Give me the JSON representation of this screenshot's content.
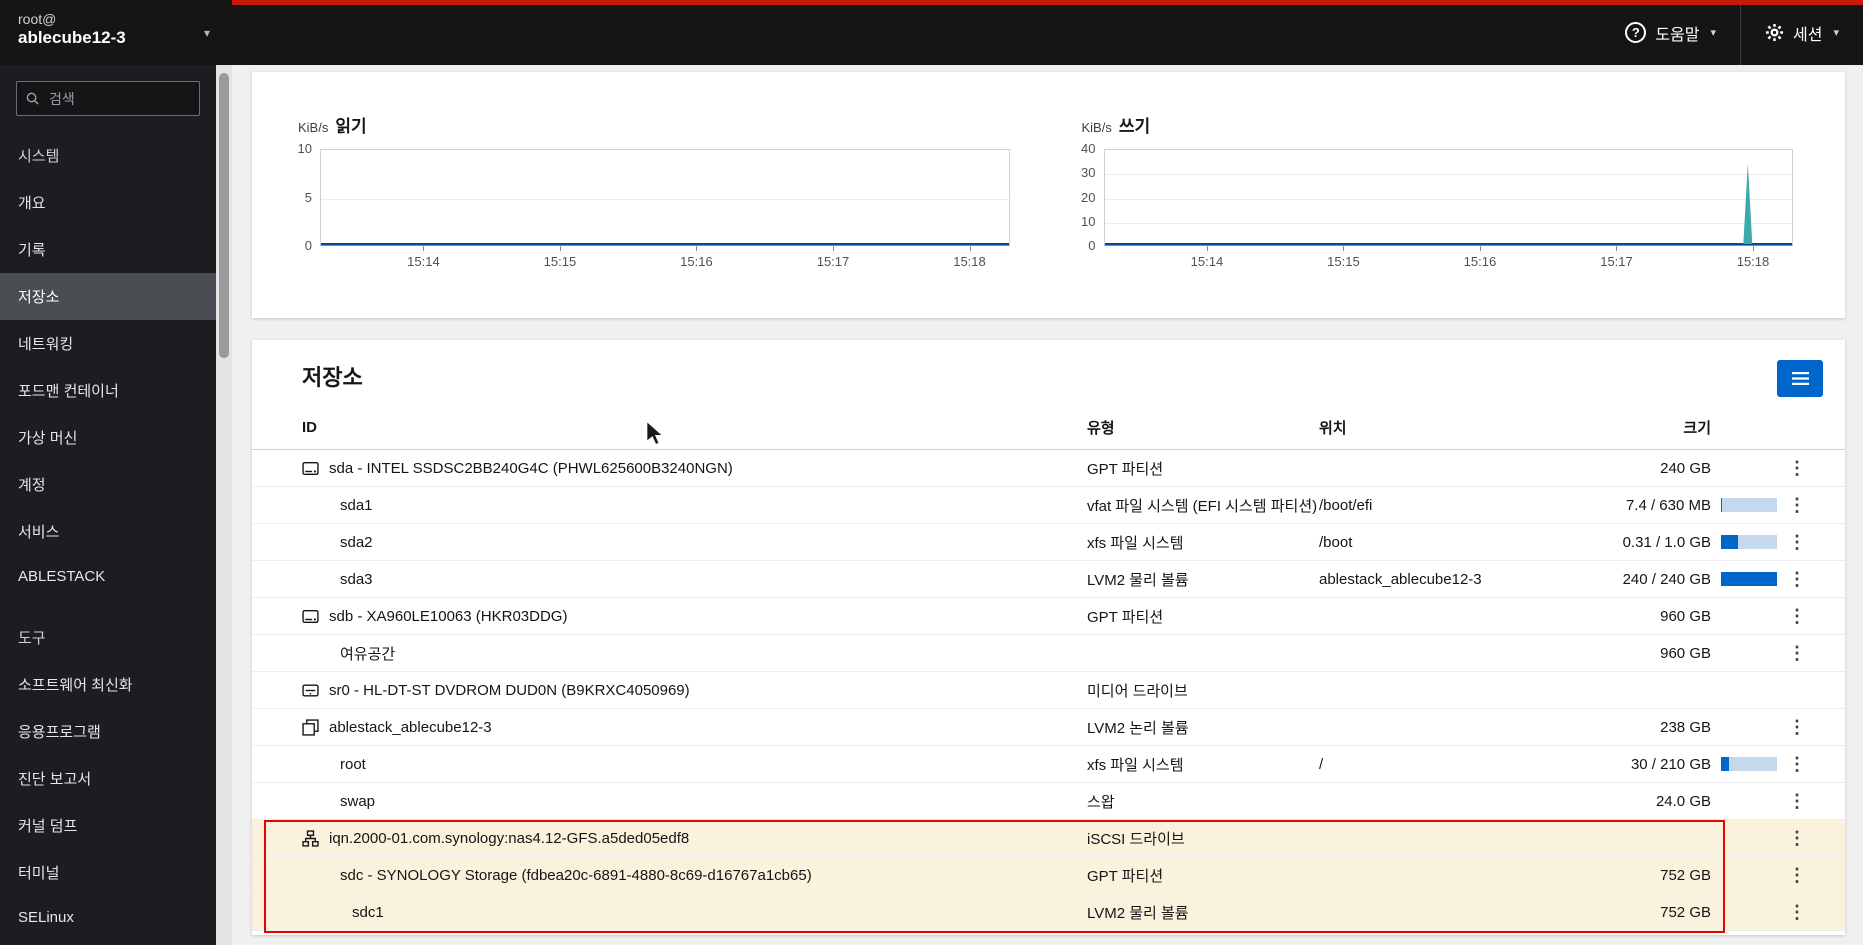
{
  "masthead": {
    "user_line": "root@",
    "host_line": "ablecube12-3",
    "help": {
      "label": "도움말",
      "icon": "question-circle-icon"
    },
    "session": {
      "label": "세션",
      "icon": "gear-icon"
    }
  },
  "sidebar": {
    "search_placeholder": "검색",
    "items": [
      {
        "key": "system",
        "label": "시스템",
        "type": "section",
        "selected": false,
        "gap_before": false
      },
      {
        "key": "overview",
        "label": "개요",
        "type": "item",
        "selected": false,
        "gap_before": false
      },
      {
        "key": "logs",
        "label": "기록",
        "type": "item",
        "selected": false,
        "gap_before": false
      },
      {
        "key": "storage",
        "label": "저장소",
        "type": "item",
        "selected": true,
        "gap_before": false
      },
      {
        "key": "networking",
        "label": "네트워킹",
        "type": "item",
        "selected": false,
        "gap_before": false
      },
      {
        "key": "podman",
        "label": "포드맨 컨테이너",
        "type": "item",
        "selected": false,
        "gap_before": false
      },
      {
        "key": "machines",
        "label": "가상 머신",
        "type": "item",
        "selected": false,
        "gap_before": false
      },
      {
        "key": "accounts",
        "label": "계정",
        "type": "item",
        "selected": false,
        "gap_before": false
      },
      {
        "key": "services",
        "label": "서비스",
        "type": "item",
        "selected": false,
        "gap_before": false
      },
      {
        "key": "ablestack",
        "label": "ABLESTACK",
        "type": "item",
        "selected": false,
        "gap_before": false
      },
      {
        "key": "tools",
        "label": "도구",
        "type": "section",
        "selected": false,
        "gap_before": true
      },
      {
        "key": "updates",
        "label": "소프트웨어 최신화",
        "type": "item",
        "selected": false,
        "gap_before": false
      },
      {
        "key": "applications",
        "label": "응용프로그램",
        "type": "item",
        "selected": false,
        "gap_before": false
      },
      {
        "key": "reports",
        "label": "진단 보고서",
        "type": "item",
        "selected": false,
        "gap_before": false
      },
      {
        "key": "kdump",
        "label": "커널 덤프",
        "type": "item",
        "selected": false,
        "gap_before": false
      },
      {
        "key": "terminal",
        "label": "터미널",
        "type": "item",
        "selected": false,
        "gap_before": false
      },
      {
        "key": "selinux",
        "label": "SELinux",
        "type": "item",
        "selected": false,
        "gap_before": false
      }
    ]
  },
  "chart_data": [
    {
      "type": "line",
      "title": "읽기",
      "unit": "KiB/s",
      "x_ticks": [
        "15:14",
        "15:15",
        "15:16",
        "15:17",
        "15:18"
      ],
      "y_ticks": [
        0,
        5,
        10
      ],
      "ylim": [
        0,
        10
      ],
      "grid": true,
      "series": [
        {
          "name": "읽기",
          "color": "#004b95",
          "values": [
            0,
            0,
            0,
            0,
            0
          ]
        }
      ]
    },
    {
      "type": "line",
      "title": "쓰기",
      "unit": "KiB/s",
      "x_ticks": [
        "15:14",
        "15:15",
        "15:16",
        "15:17",
        "15:18"
      ],
      "y_ticks": [
        0,
        10,
        20,
        30,
        40
      ],
      "ylim": [
        0,
        40
      ],
      "grid": true,
      "series": [
        {
          "name": "쓰기",
          "color": "#004b95",
          "values": [
            0,
            0,
            0,
            0,
            0
          ]
        }
      ],
      "spike": {
        "at": "15:18",
        "x_frac": 0.935,
        "value": 34,
        "color": "#3aabab"
      }
    }
  ],
  "storage": {
    "title": "저장소",
    "columns": [
      "ID",
      "유형",
      "위치",
      "크기"
    ],
    "rows": [
      {
        "icon": "disk-icon",
        "indent": 0,
        "id": "sda - INTEL SSDSC2BB240G4C (PHWL625600B3240NGN)",
        "type": "GPT 파티션",
        "location": "",
        "size": "240 GB",
        "usage": null,
        "kebab": true,
        "highlight": false
      },
      {
        "icon": null,
        "indent": 1,
        "id": "sda1",
        "type": "vfat 파일 시스템 (EFI 시스템 파티션)",
        "location": "/boot/efi",
        "size": "7.4 / 630 MB",
        "usage": 0.012,
        "kebab": true,
        "highlight": false
      },
      {
        "icon": null,
        "indent": 1,
        "id": "sda2",
        "type": "xfs 파일 시스템",
        "location": "/boot",
        "size": "0.31 / 1.0 GB",
        "usage": 0.31,
        "kebab": true,
        "highlight": false
      },
      {
        "icon": null,
        "indent": 1,
        "id": "sda3",
        "type": "LVM2 물리 볼륨",
        "location": "ablestack_ablecube12-3",
        "size": "240 / 240 GB",
        "usage": 1.0,
        "kebab": true,
        "highlight": false
      },
      {
        "icon": "disk-icon",
        "indent": 0,
        "id": "sdb - XA960LE10063 (HKR03DDG)",
        "type": "GPT 파티션",
        "location": "",
        "size": "960 GB",
        "usage": null,
        "kebab": true,
        "highlight": false
      },
      {
        "icon": null,
        "indent": 1,
        "id": "여유공간",
        "type": "",
        "location": "",
        "size": "960 GB",
        "usage": null,
        "kebab": true,
        "highlight": false
      },
      {
        "icon": "optical-drive-icon",
        "indent": 0,
        "id": "sr0 - HL-DT-ST DVDROM DUD0N (B9KRXC4050969)",
        "type": "미디어 드라이브",
        "location": "",
        "size": "",
        "usage": null,
        "kebab": false,
        "highlight": false
      },
      {
        "icon": "volume-group-icon",
        "indent": 0,
        "id": "ablestack_ablecube12-3",
        "type": "LVM2 논리 볼륨",
        "location": "",
        "size": "238 GB",
        "usage": null,
        "kebab": true,
        "highlight": false
      },
      {
        "icon": null,
        "indent": 1,
        "id": "root",
        "type": "xfs 파일 시스템",
        "location": "/",
        "size": "30 / 210 GB",
        "usage": 0.143,
        "kebab": true,
        "highlight": false
      },
      {
        "icon": null,
        "indent": 1,
        "id": "swap",
        "type": "스왑",
        "location": "",
        "size": "24.0 GB",
        "usage": null,
        "kebab": true,
        "highlight": false
      },
      {
        "icon": "iscsi-icon",
        "indent": 0,
        "id": "iqn.2000-01.com.synology:nas4.12-GFS.a5ded05edf8",
        "type": "iSCSI 드라이브",
        "location": "",
        "size": "",
        "usage": null,
        "kebab": true,
        "highlight": true
      },
      {
        "icon": null,
        "indent": 1,
        "id": "sdc - SYNOLOGY Storage (fdbea20c-6891-4880-8c69-d16767a1cb65)",
        "type": "GPT 파티션",
        "location": "",
        "size": "752 GB",
        "usage": null,
        "kebab": true,
        "highlight": true
      },
      {
        "icon": null,
        "indent": 2,
        "id": "sdc1",
        "type": "LVM2 물리 볼륨",
        "location": "",
        "size": "752 GB",
        "usage": null,
        "kebab": true,
        "highlight": true
      }
    ]
  },
  "colors": {
    "accent_red": "#c9190b",
    "primary_blue": "#0066cc",
    "row_highlight_bg": "#fbf2dd",
    "annotation_red": "#e10600",
    "usage_fill": "#0066cc",
    "usage_track": "#c5d9ed",
    "series_line": "#004b95",
    "spike_teal": "#3aabab"
  }
}
